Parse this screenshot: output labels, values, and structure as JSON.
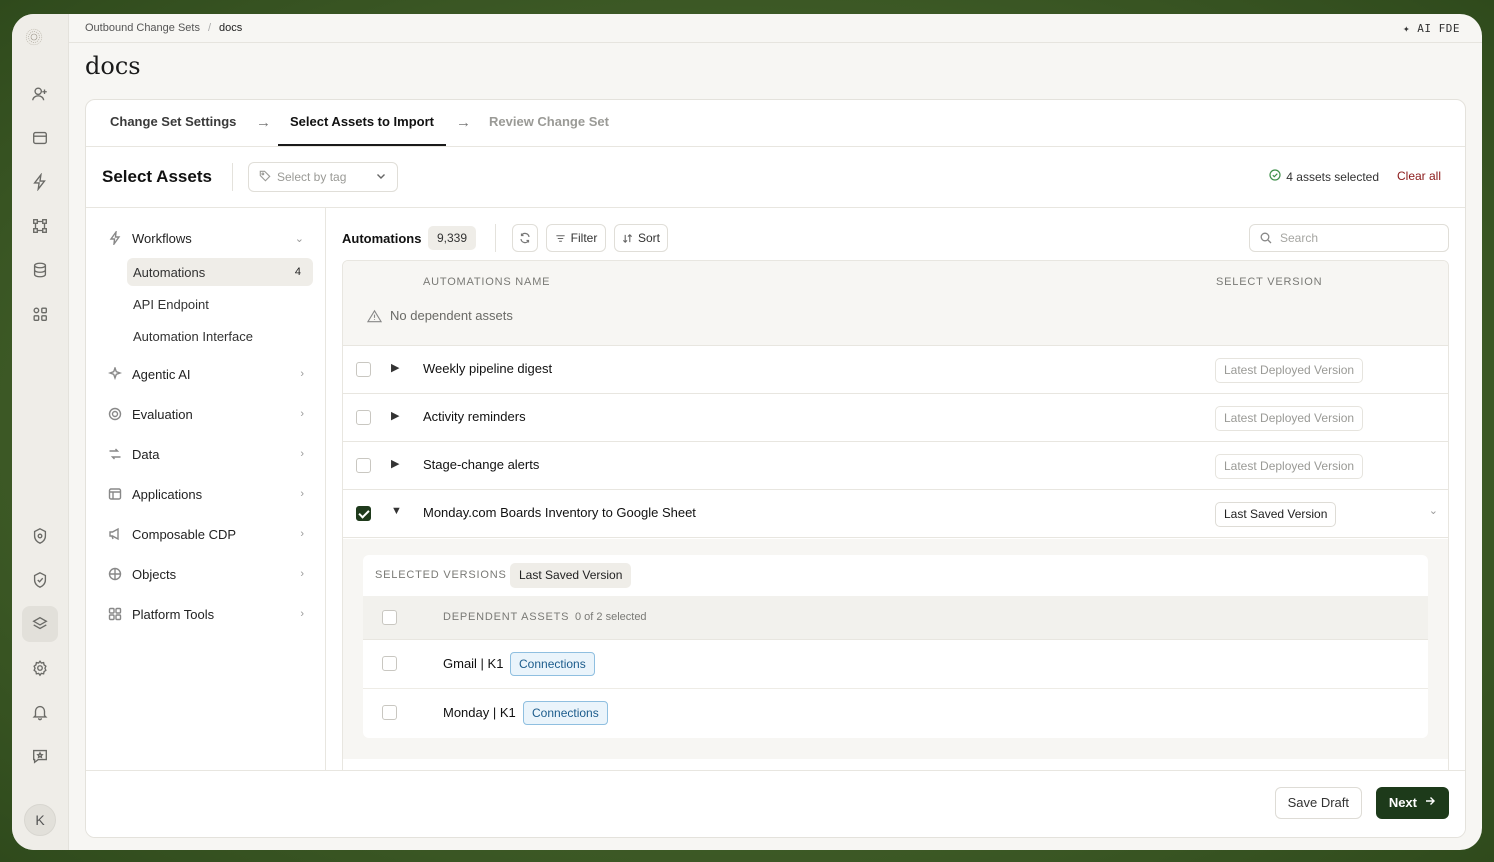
{
  "breadcrumb": {
    "parent": "Outbound Change Sets",
    "separator": "/",
    "current": "docs"
  },
  "top_right": "✦ AI FDE",
  "page_title": "docs",
  "steps": [
    {
      "label": "Change Set Settings",
      "state": "done"
    },
    {
      "label": "Select Assets to Import",
      "state": "active"
    },
    {
      "label": "Review Change Set",
      "state": "todo"
    }
  ],
  "step_arrow": "→",
  "select_assets": {
    "title": "Select Assets",
    "tag_placeholder": "Select by tag",
    "selected_count": "4 assets selected",
    "clear_all": "Clear all"
  },
  "sidenav": {
    "workflows": {
      "label": "Workflows",
      "icon": "lightning-icon"
    },
    "sub": [
      {
        "label": "Automations",
        "badge": "4",
        "selected": true
      },
      {
        "label": "API Endpoint",
        "badge": ""
      },
      {
        "label": "Automation Interface",
        "badge": ""
      }
    ],
    "items": [
      {
        "label": "Agentic AI",
        "icon": "sparkle-icon"
      },
      {
        "label": "Evaluation",
        "icon": "target-icon"
      },
      {
        "label": "Data",
        "icon": "data-flow-icon"
      },
      {
        "label": "Applications",
        "icon": "app-window-icon"
      },
      {
        "label": "Composable CDP",
        "icon": "megaphone-icon"
      },
      {
        "label": "Objects",
        "icon": "grid-icon"
      },
      {
        "label": "Platform Tools",
        "icon": "tools-icon"
      }
    ]
  },
  "toolbar": {
    "title": "Automations",
    "count": "9,339",
    "filter": "Filter",
    "sort": "Sort",
    "search_placeholder": "Search"
  },
  "table": {
    "col_name": "AUTOMATIONS NAME",
    "col_version": "SELECT VERSION",
    "no_dependent": "No dependent assets",
    "rows": [
      {
        "name": "Weekly pipeline digest",
        "version": "Latest Deployed Version",
        "checked": false,
        "expanded": false
      },
      {
        "name": "Activity reminders",
        "version": "Latest Deployed Version",
        "checked": false,
        "expanded": false
      },
      {
        "name": "Stage-change alerts",
        "version": "Latest Deployed Version",
        "checked": false,
        "expanded": false
      },
      {
        "name": "Monday.com Boards Inventory to Google Sheet",
        "version": "Last Saved Version",
        "checked": true,
        "expanded": true
      }
    ]
  },
  "expanded": {
    "selected_versions_label": "SELECTED VERSIONS",
    "selected_version": "Last Saved Version",
    "dependent_label": "DEPENDENT ASSETS",
    "dependent_count": "0 of 2 selected",
    "assets": [
      {
        "name": "Gmail | K1",
        "tag": "Connections"
      },
      {
        "name": "Monday | K1",
        "tag": "Connections"
      }
    ]
  },
  "footer": {
    "save_draft": "Save Draft",
    "next": "Next"
  },
  "user_initial": "K",
  "colors": {
    "accent": "#1d3a1a",
    "clear_all": "#8b1a1a",
    "connection_tag": "#1c5c8c"
  }
}
